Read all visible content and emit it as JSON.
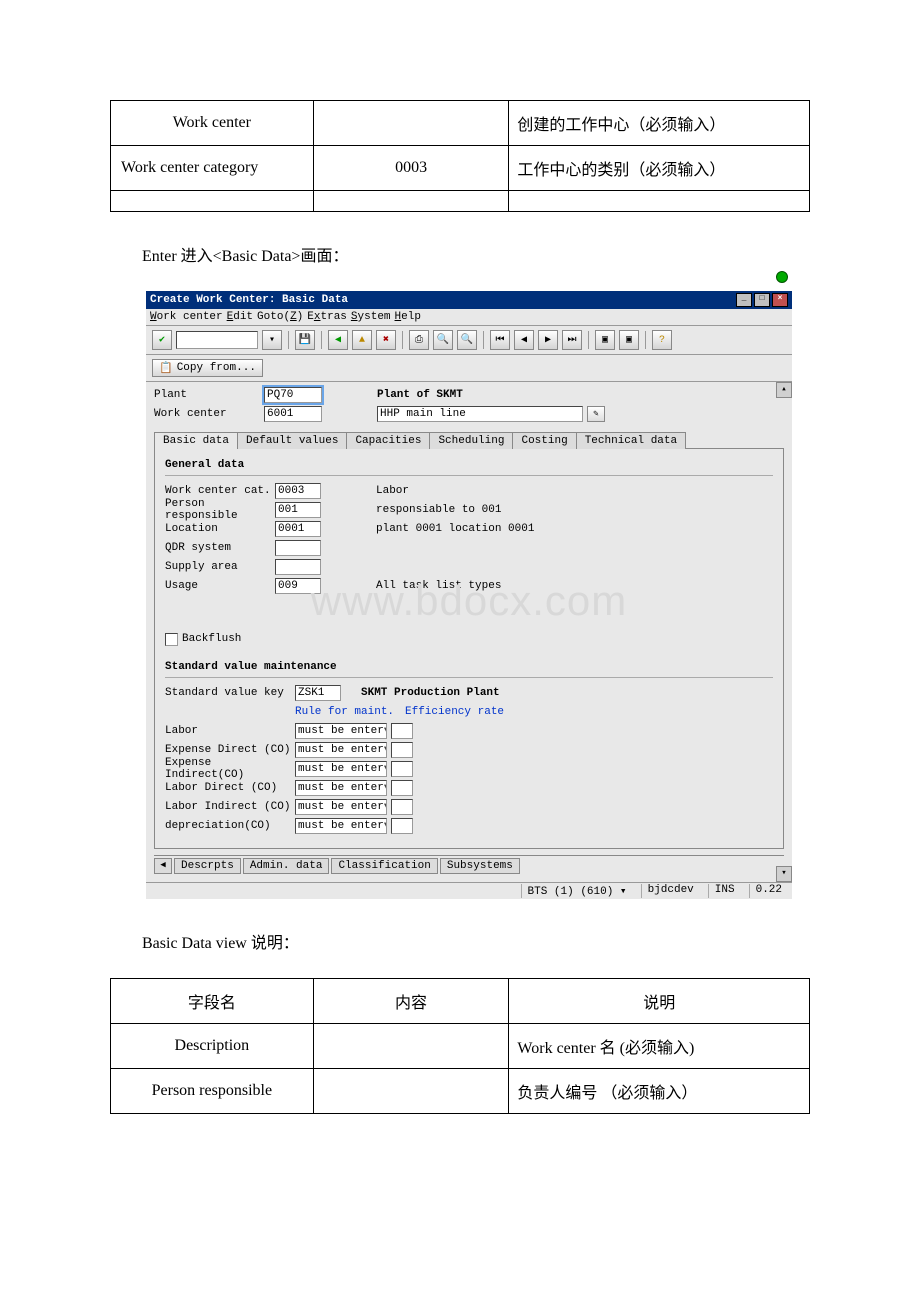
{
  "table1": {
    "rows": [
      {
        "c1": "Work center",
        "c2": "",
        "c3": "创建的工作中心（必须输入）",
        "c1_align": "center"
      },
      {
        "c1": "Work center category",
        "c2": "0003",
        "c3": "工作中心的类别（必须输入）",
        "c1_align": "left"
      },
      {
        "c1": "",
        "c2": "",
        "c3": "",
        "c1_align": "left"
      }
    ]
  },
  "para1": "Enter 进入<Basic Data>画面：",
  "sap": {
    "title": "Create Work Center: Basic Data",
    "menu": [
      "Work center",
      "Edit",
      "Goto(Z)",
      "Extras",
      "System",
      "Help"
    ],
    "copy_from": "Copy from...",
    "plant_lbl": "Plant",
    "plant_val": "PQ70",
    "plant_desc": "Plant of SKMT",
    "wc_lbl": "Work center",
    "wc_val": "6001",
    "wc_desc": "HHP main line",
    "tabs": [
      "Basic data",
      "Default values",
      "Capacities",
      "Scheduling",
      "Costing",
      "Technical data"
    ],
    "general": {
      "title": "General data",
      "rows": [
        {
          "lbl": "Work center cat.",
          "val": "0003",
          "desc": "Labor"
        },
        {
          "lbl": "Person responsible",
          "val": "001",
          "desc": "responsiable to 001"
        },
        {
          "lbl": "Location",
          "val": "0001",
          "desc": "plant 0001 location 0001"
        },
        {
          "lbl": "QDR system",
          "val": "",
          "desc": ""
        },
        {
          "lbl": "Supply area",
          "val": "",
          "desc": ""
        },
        {
          "lbl": "Usage",
          "val": "009",
          "desc": "All task list types"
        }
      ],
      "backflush": "Backflush"
    },
    "svm": {
      "title": "Standard value maintenance",
      "svk_lbl": "Standard value key",
      "svk_val": "ZSK1",
      "svk_desc": "SKMT Production Plant",
      "rule_lbl": "Rule for maint.",
      "eff_lbl": "Efficiency rate",
      "rows": [
        {
          "lbl": "Labor",
          "dd": "must be enter"
        },
        {
          "lbl": "Expense Direct (CO)",
          "dd": "must be enter"
        },
        {
          "lbl": "Expense Indirect(CO)",
          "dd": "must be enter"
        },
        {
          "lbl": "Labor Direct (CO)",
          "dd": "must be enter"
        },
        {
          "lbl": "Labor Indirect (CO)",
          "dd": "must be enter"
        },
        {
          "lbl": "depreciation(CO)",
          "dd": "must be enter"
        }
      ]
    },
    "bottom_tabs": [
      "Descrpts",
      "Admin. data",
      "Classification",
      "Subsystems"
    ],
    "status": {
      "sys": "BTS (1) (610) ▾",
      "host": "bjdcdev",
      "mode": "INS",
      "time": "0.22"
    }
  },
  "watermark": "www.bdocx.com",
  "para2": "Basic Data view   说明：",
  "table2": {
    "head": {
      "c1": "字段名",
      "c2": "内容",
      "c3": "说明"
    },
    "rows": [
      {
        "c1": "Description",
        "c2": "",
        "c3": "Work center 名 (必须输入)"
      },
      {
        "c1": "Person responsible",
        "c2": "",
        "c3": "负责人编号 （必须输入）"
      }
    ]
  }
}
